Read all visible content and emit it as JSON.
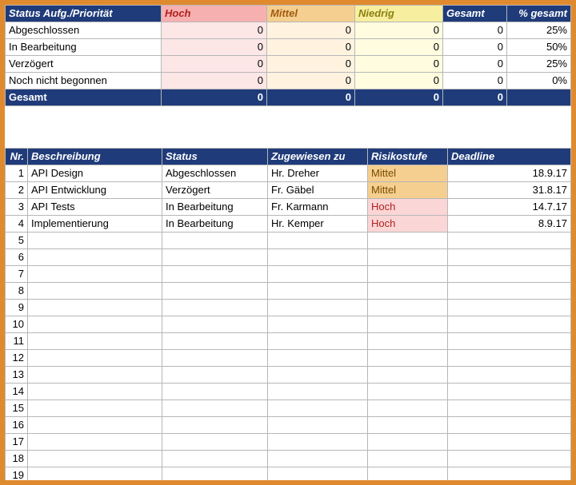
{
  "summary": {
    "headers": {
      "status": "Status Aufg./Priorität",
      "hoch": "Hoch",
      "mittel": "Mittel",
      "niedrig": "Niedrig",
      "gesamt": "Gesamt",
      "pct": "% gesamt"
    },
    "rows": [
      {
        "label": "Abgeschlossen",
        "hoch": "0",
        "mittel": "0",
        "niedrig": "0",
        "gesamt": "0",
        "pct": "25%"
      },
      {
        "label": "In Bearbeitung",
        "hoch": "0",
        "mittel": "0",
        "niedrig": "0",
        "gesamt": "0",
        "pct": "50%"
      },
      {
        "label": "Verzögert",
        "hoch": "0",
        "mittel": "0",
        "niedrig": "0",
        "gesamt": "0",
        "pct": "25%"
      },
      {
        "label": "Noch nicht begonnen",
        "hoch": "0",
        "mittel": "0",
        "niedrig": "0",
        "gesamt": "0",
        "pct": "0%"
      }
    ],
    "total": {
      "label": "Gesamt",
      "hoch": "0",
      "mittel": "0",
      "niedrig": "0",
      "gesamt": "0",
      "pct": ""
    }
  },
  "detail": {
    "headers": {
      "nr": "Nr.",
      "beschreibung": "Beschreibung",
      "status": "Status",
      "zugewiesen": "Zugewiesen zu",
      "risiko": "Risikostufe",
      "deadline": "Deadline"
    },
    "rows": [
      {
        "nr": "1",
        "beschreibung": "API Design",
        "status": "Abgeschlossen",
        "zugewiesen": "Hr. Dreher",
        "risiko": "Mittel",
        "deadline": "18.9.17"
      },
      {
        "nr": "2",
        "beschreibung": "API Entwicklung",
        "status": "Verzögert",
        "zugewiesen": "Fr. Gäbel",
        "risiko": "Mittel",
        "deadline": "31.8.17"
      },
      {
        "nr": "3",
        "beschreibung": "API Tests",
        "status": "In Bearbeitung",
        "zugewiesen": "Fr. Karmann",
        "risiko": "Hoch",
        "deadline": "14.7.17"
      },
      {
        "nr": "4",
        "beschreibung": "Implementierung",
        "status": "In Bearbeitung",
        "zugewiesen": "Hr. Kemper",
        "risiko": "Hoch",
        "deadline": "8.9.17"
      },
      {
        "nr": "5",
        "beschreibung": "",
        "status": "",
        "zugewiesen": "",
        "risiko": "",
        "deadline": ""
      },
      {
        "nr": "6",
        "beschreibung": "",
        "status": "",
        "zugewiesen": "",
        "risiko": "",
        "deadline": ""
      },
      {
        "nr": "7",
        "beschreibung": "",
        "status": "",
        "zugewiesen": "",
        "risiko": "",
        "deadline": ""
      },
      {
        "nr": "8",
        "beschreibung": "",
        "status": "",
        "zugewiesen": "",
        "risiko": "",
        "deadline": ""
      },
      {
        "nr": "9",
        "beschreibung": "",
        "status": "",
        "zugewiesen": "",
        "risiko": "",
        "deadline": ""
      },
      {
        "nr": "10",
        "beschreibung": "",
        "status": "",
        "zugewiesen": "",
        "risiko": "",
        "deadline": ""
      },
      {
        "nr": "11",
        "beschreibung": "",
        "status": "",
        "zugewiesen": "",
        "risiko": "",
        "deadline": ""
      },
      {
        "nr": "12",
        "beschreibung": "",
        "status": "",
        "zugewiesen": "",
        "risiko": "",
        "deadline": ""
      },
      {
        "nr": "13",
        "beschreibung": "",
        "status": "",
        "zugewiesen": "",
        "risiko": "",
        "deadline": ""
      },
      {
        "nr": "14",
        "beschreibung": "",
        "status": "",
        "zugewiesen": "",
        "risiko": "",
        "deadline": ""
      },
      {
        "nr": "15",
        "beschreibung": "",
        "status": "",
        "zugewiesen": "",
        "risiko": "",
        "deadline": ""
      },
      {
        "nr": "16",
        "beschreibung": "",
        "status": "",
        "zugewiesen": "",
        "risiko": "",
        "deadline": ""
      },
      {
        "nr": "17",
        "beschreibung": "",
        "status": "",
        "zugewiesen": "",
        "risiko": "",
        "deadline": ""
      },
      {
        "nr": "18",
        "beschreibung": "",
        "status": "",
        "zugewiesen": "",
        "risiko": "",
        "deadline": ""
      },
      {
        "nr": "19",
        "beschreibung": "",
        "status": "",
        "zugewiesen": "",
        "risiko": "",
        "deadline": ""
      }
    ]
  }
}
